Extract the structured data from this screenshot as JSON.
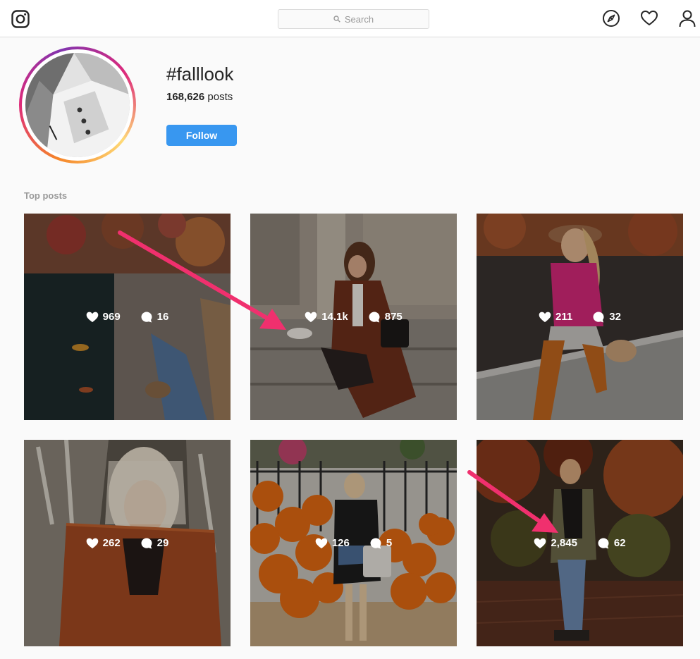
{
  "nav": {
    "search_placeholder": "Search"
  },
  "header": {
    "hashtag": "#falllook",
    "post_count": "168,626",
    "post_suffix": " posts",
    "follow_label": "Follow"
  },
  "section": {
    "top_posts_label": "Top posts"
  },
  "posts": [
    {
      "likes": "969",
      "comments": "16"
    },
    {
      "likes": "14.1k",
      "comments": "875"
    },
    {
      "likes": "211",
      "comments": "32"
    },
    {
      "likes": "262",
      "comments": "29"
    },
    {
      "likes": "126",
      "comments": "5"
    },
    {
      "likes": "2,845",
      "comments": "62"
    }
  ],
  "colors": {
    "accent": "#3897f0",
    "annotation_arrow": "#f0306e"
  },
  "icons": {
    "logo": "instagram-icon",
    "explore": "compass-icon",
    "activity": "heart-icon",
    "profile": "user-icon",
    "like": "heart-icon",
    "comment": "comment-icon"
  }
}
